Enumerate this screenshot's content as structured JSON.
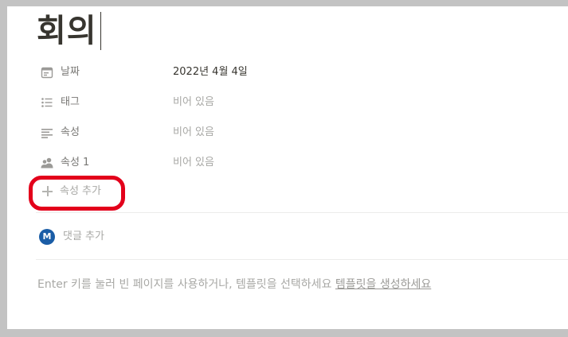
{
  "page": {
    "title": "회의"
  },
  "properties": [
    {
      "icon": "calendar-icon",
      "label": "날짜",
      "value": "2022년 4월 4일",
      "empty": false
    },
    {
      "icon": "list-icon",
      "label": "태그",
      "value": "비어 있음",
      "empty": true
    },
    {
      "icon": "text-lines-icon",
      "label": "속성",
      "value": "비어 있음",
      "empty": true
    },
    {
      "icon": "people-icon",
      "label": "속성 1",
      "value": "비어 있음",
      "empty": true
    }
  ],
  "add_property": {
    "label": "속성 추가",
    "icon": "plus-icon"
  },
  "comment": {
    "avatar_letter": "M",
    "label": "댓글 추가"
  },
  "hint": {
    "text": "Enter 키를 눌러 빈 페이지를 사용하거나, 템플릿을 선택하세요 ",
    "link": "템플릿을 생성하세요"
  },
  "colors": {
    "highlight": "#e3001b",
    "avatar": "#1a5da6"
  }
}
